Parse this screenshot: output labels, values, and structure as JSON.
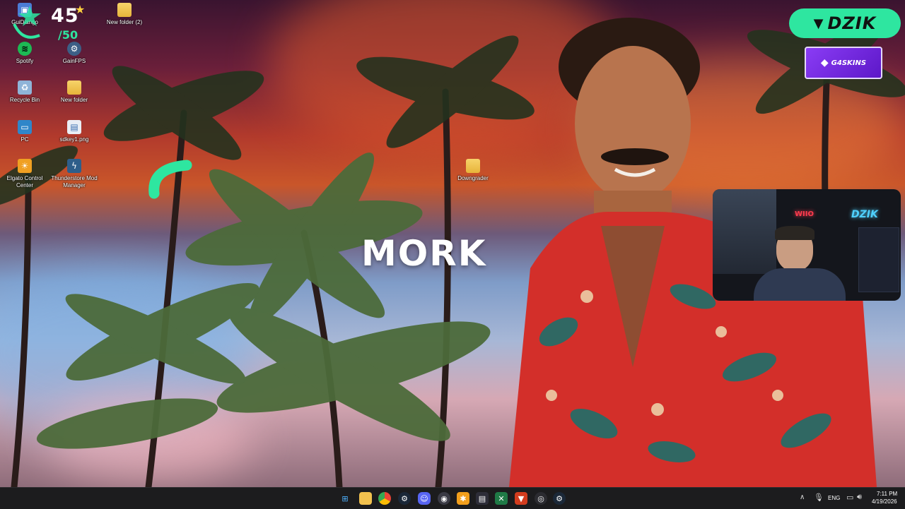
{
  "overlay": {
    "counter_value": "45",
    "counter_goal": "/50",
    "wallpaper_title": "MORK",
    "brand_logo_text": "DZIK",
    "sponsor_logo_text": "G4SKINS",
    "webcam_sign_left": "WIIO",
    "webcam_sign_right": "DZIK"
  },
  "desktop_icons": [
    {
      "label": "GuiDiango",
      "icon": "app-icon"
    },
    {
      "label": "New folder (2)",
      "icon": "folder-icon"
    },
    {
      "label": "Spotify",
      "icon": "spotify-icon"
    },
    {
      "label": "GainFPS",
      "icon": "gear-icon"
    },
    {
      "label": "Recycle Bin",
      "icon": "recycle-bin-icon"
    },
    {
      "label": "New folder",
      "icon": "folder-icon"
    },
    {
      "label": "PC",
      "icon": "monitor-icon"
    },
    {
      "label": "sdkey1.png",
      "icon": "image-file-icon"
    },
    {
      "label": "Elgato Control Center",
      "icon": "elgato-icon"
    },
    {
      "label": "Thunderstore Mod Manager",
      "icon": "thunderstore-icon"
    },
    {
      "label": "Downgrader",
      "icon": "folder-icon"
    }
  ],
  "taskbar": {
    "apps": [
      "windows-start-icon",
      "file-explorer-icon",
      "chrome-icon",
      "steam-icon",
      "discord-icon",
      "app-icon",
      "app-icon",
      "app-icon",
      "excel-icon",
      "brave-icon",
      "obs-icon",
      "steam-icon"
    ],
    "language": "ENG",
    "time": "7:11 PM",
    "date": "4/19/2026"
  },
  "colors": {
    "accent_green": "#2ee6a0",
    "sponsor_purple": "#7b2cf0",
    "taskbar_bg": "#1c1c1e"
  }
}
